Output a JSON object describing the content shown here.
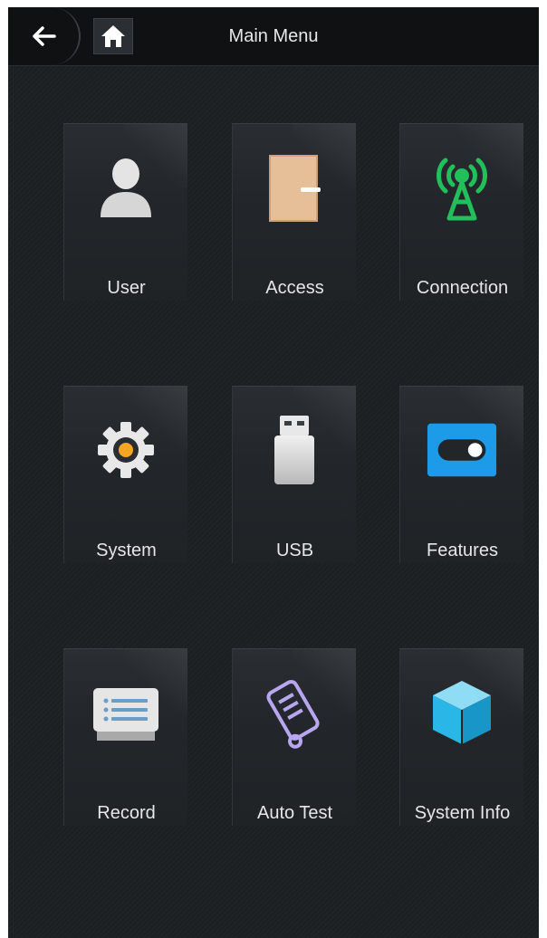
{
  "header": {
    "title": "Main Menu",
    "back_icon": "arrow-left-icon",
    "home_icon": "home-icon"
  },
  "menu": [
    {
      "label": "User",
      "icon": "user-icon",
      "color": "#dcdcdc"
    },
    {
      "label": "Access",
      "icon": "door-icon",
      "color": "#e2b88f"
    },
    {
      "label": "Connection",
      "icon": "antenna-icon",
      "color": "#22c05a"
    },
    {
      "label": "System",
      "icon": "gear-icon",
      "color": "#f5a623"
    },
    {
      "label": "USB",
      "icon": "usb-icon",
      "color": "#d8d8d8"
    },
    {
      "label": "Features",
      "icon": "toggle-icon",
      "color": "#1e9be8"
    },
    {
      "label": "Record",
      "icon": "record-icon",
      "color": "#dcdcdc"
    },
    {
      "label": "Auto Test",
      "icon": "auto-test-icon",
      "color": "#b9a6f0"
    },
    {
      "label": "System Info",
      "icon": "cube-icon",
      "color": "#2bb6e8"
    }
  ]
}
